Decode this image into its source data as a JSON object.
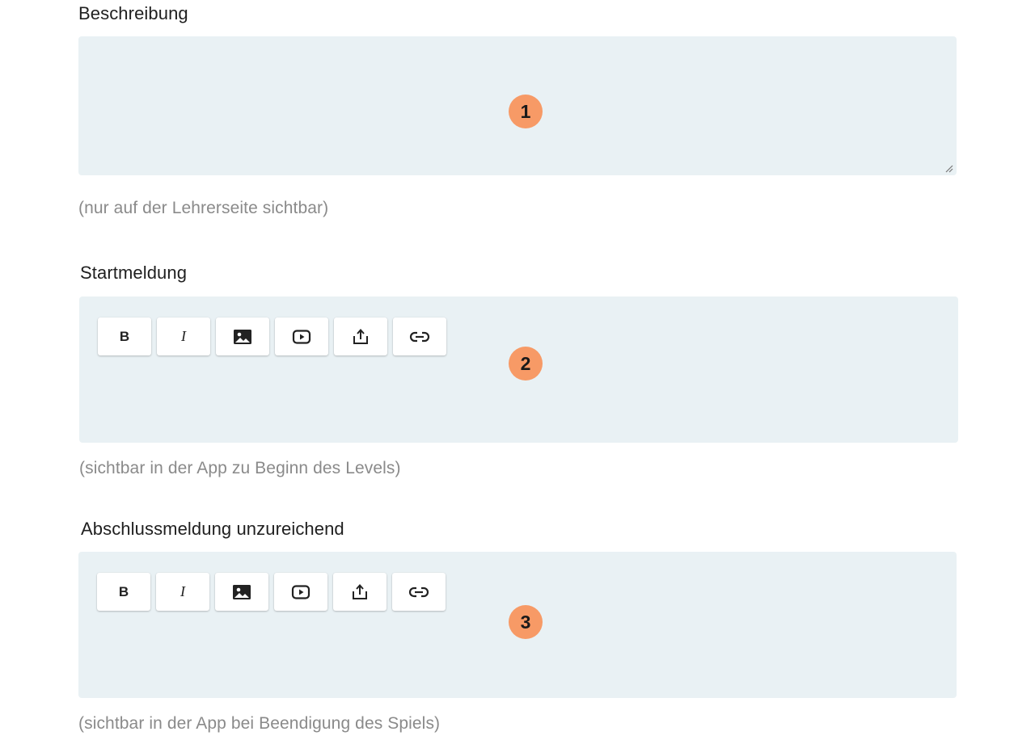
{
  "sections": [
    {
      "label": "Beschreibung",
      "hint": "(nur auf der Lehrerseite sichtbar)",
      "badge": "1",
      "value": ""
    },
    {
      "label": "Startmeldung",
      "hint": "(sichtbar in der App zu Beginn des Levels)",
      "badge": "2",
      "value": ""
    },
    {
      "label": "Abschlussmeldung unzureichend",
      "hint": "(sichtbar in der App bei Beendigung des Spiels)",
      "badge": "3",
      "value": ""
    }
  ],
  "toolbar": {
    "bold_label": "B",
    "italic_label": "I",
    "icons": [
      "image-icon",
      "video-icon",
      "upload-icon",
      "link-icon"
    ]
  },
  "colors": {
    "field_background": "#e9f1f4",
    "badge": "#f79a66",
    "hint_text": "#8a8a8a"
  }
}
